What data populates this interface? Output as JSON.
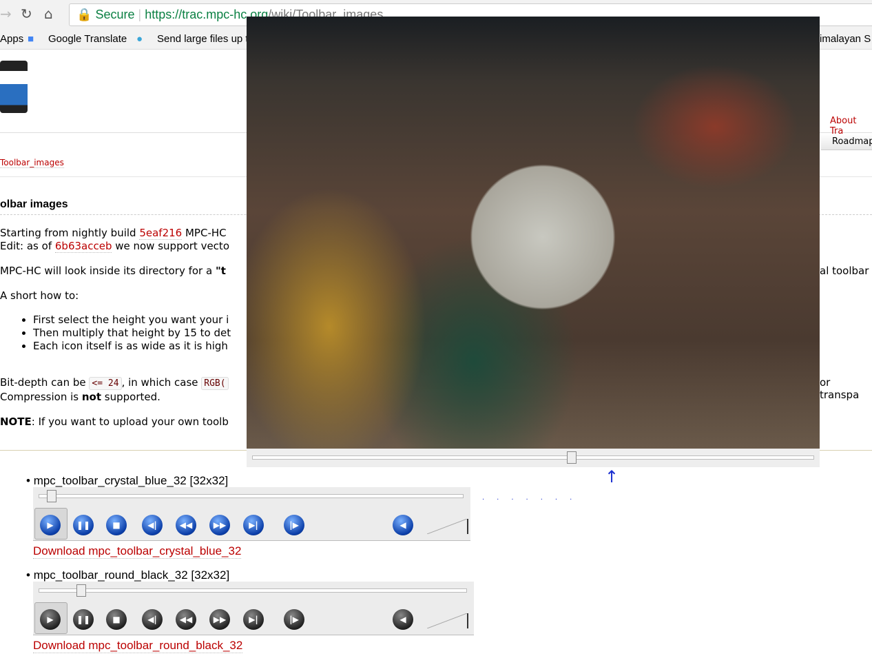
{
  "browser": {
    "secure_label": "Secure",
    "url_host": "https://trac.mpc-hc.org",
    "url_path": "/wiki/Toolbar_images",
    "bookmarks": [
      "Apps",
      "Google Translate",
      "Send large files up t",
      "imalayan S"
    ]
  },
  "nav": {
    "about": "About Tra",
    "roadmap": "Roadmap"
  },
  "breadcrumb": "Toolbar_images",
  "page": {
    "title": "olbar images",
    "p1_a": "Starting from nightly build ",
    "p1_link": "5eaf216",
    "p1_b": " MPC-HC",
    "p2_a": "Edit: as of ",
    "p2_link": "6b63acceb",
    "p2_b": " we now support vecto",
    "p3_a": "MPC-HC will look inside its directory for a ",
    "p3_b": "\"t",
    "p3_right": "al toolbar",
    "p4": "A short how to:",
    "bullets": [
      "First select the height you want your i",
      "Then multiply that height by 15 to det",
      "Each icon itself is as wide as it is high"
    ],
    "p5_a": "Bit-depth can be ",
    "p5_code1": "<= 24",
    "p5_b": ", in which case ",
    "p5_code2": "RGB(",
    "p5_right": "or transpa",
    "p6_a": "Compression is ",
    "p6_bold": "not",
    "p6_b": " supported.",
    "note_bold": "NOTE",
    "note": ": If you want to upload your own toolb"
  },
  "toolbars": [
    {
      "name": "mpc_toolbar_crystal_blue_32 [32x32]",
      "download": "Download mpc_toolbar_crystal_blue_32",
      "seek": 0.02
    },
    {
      "name": "mpc_toolbar_round_black_32 [32x32]",
      "download": "Download mpc_toolbar_round_black_32",
      "seek": 0.09
    }
  ],
  "buttons": [
    "play",
    "pause",
    "stop",
    "prev",
    "rewind",
    "forward",
    "next",
    "frame-step"
  ],
  "player": {
    "seek": 0.56
  },
  "annotation": "↑"
}
